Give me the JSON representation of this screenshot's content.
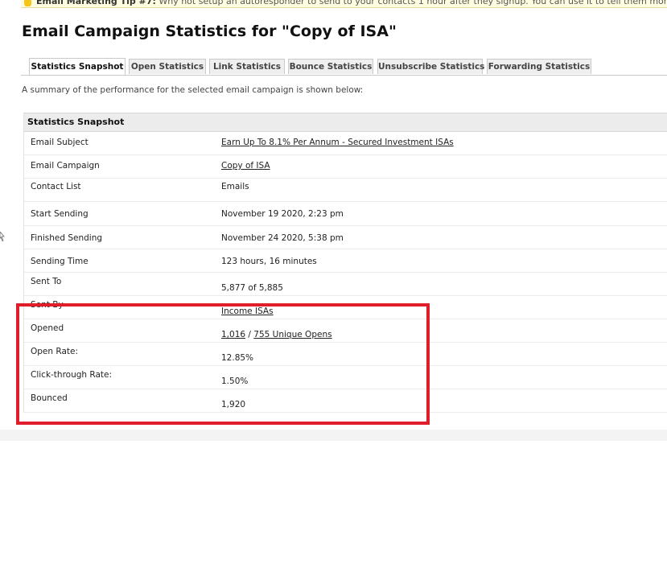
{
  "tip": {
    "label": "Email Marketing Tip #7:",
    "text": "Why not setup an autoresponder to send to your contacts 1 hour after they signup. You can use it to tell them more about your company"
  },
  "page_title": "Email Campaign Statistics for \"Copy of ISA\"",
  "tabs": [
    {
      "label": "Statistics Snapshot",
      "active": true
    },
    {
      "label": "Open Statistics",
      "active": false
    },
    {
      "label": "Link Statistics",
      "active": false
    },
    {
      "label": "Bounce Statistics",
      "active": false
    },
    {
      "label": "Unsubscribe Statistics",
      "active": false
    },
    {
      "label": "Forwarding Statistics",
      "active": false
    }
  ],
  "summary_text": "A summary of the performance for the selected email campaign is shown below:",
  "snapshot": {
    "header": "Statistics Snapshot",
    "email_subject": {
      "label": "Email Subject",
      "value": "Earn Up To 8.1% Per Annum - Secured Investment ISAs"
    },
    "email_campaign": {
      "label": "Email Campaign",
      "value": "Copy of ISA"
    },
    "contact_list": {
      "label": "Contact List",
      "value": "Emails"
    },
    "start_sending": {
      "label": "Start Sending",
      "value": "November 19 2020, 2:23 pm"
    },
    "finished_sending": {
      "label": "Finished Sending",
      "value": "November 24 2020, 5:38 pm"
    },
    "sending_time": {
      "label": "Sending Time",
      "value": "123 hours, 16 minutes"
    },
    "sent_to": {
      "label": "Sent To",
      "value": "5,877 of 5,885"
    },
    "sent_by": {
      "label": "Sent By",
      "value": "Income ISAs"
    },
    "opened": {
      "label": "Opened",
      "total": "1,016",
      "separator": "/",
      "unique": "755 Unique Opens"
    },
    "open_rate": {
      "label": "Open Rate:",
      "value": "12.85%"
    },
    "click_through_rate": {
      "label": "Click-through Rate:",
      "value": "1.50%"
    },
    "bounced": {
      "label": "Bounced",
      "value": "1,920"
    }
  },
  "colors": {
    "highlight": "#e01e2b",
    "tip_background": "#fffde0"
  }
}
